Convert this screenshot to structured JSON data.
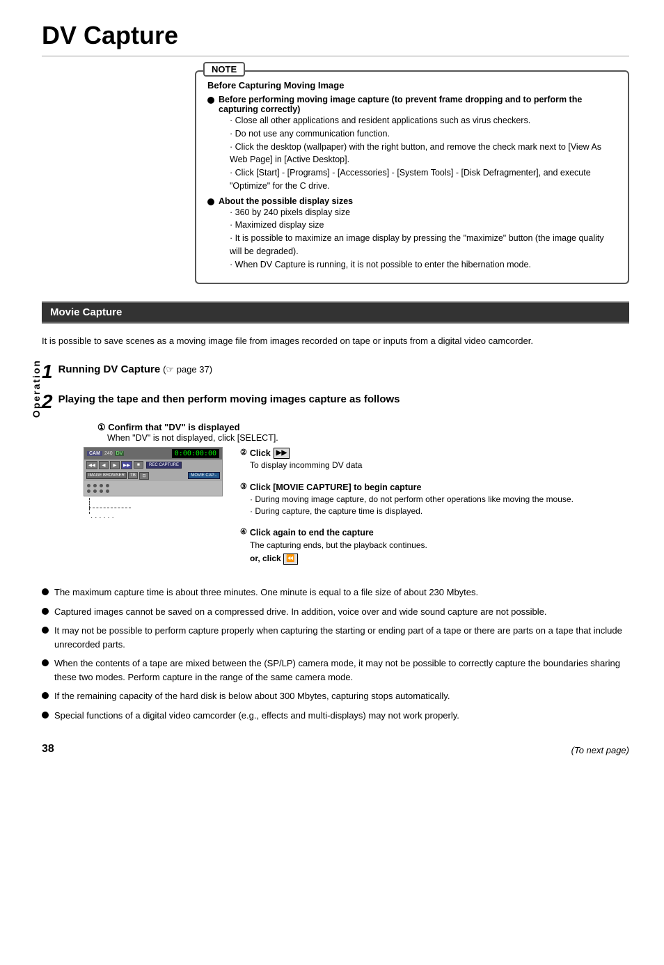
{
  "page": {
    "title": "DV Capture",
    "sidebar_label": "Operation",
    "page_number": "38",
    "next_page_text": "(To next page)"
  },
  "note": {
    "label": "NOTE",
    "title": "Before Capturing Moving Image",
    "bullets": [
      {
        "text_bold": "Before performing moving image capture (to prevent frame dropping and to perform the capturing correctly)",
        "sub_items": [
          "Close all other applications and resident applications such as virus checkers.",
          "Do not use any communication function.",
          "Click the desktop (wallpaper) with the right button, and remove the check mark next to [View As Web Page] in [Active Desktop].",
          "Click [Start] - [Programs] - [Accessories] - [System Tools] - [Disk Defragmenter], and execute \"Optimize\" for the C drive."
        ]
      },
      {
        "text_bold": "About the possible display sizes",
        "sub_items": [
          "360 by 240 pixels display size",
          "Maximized display size",
          "It is possible to maximize an image display by pressing the \"maximize\" button (the image quality will be degraded).",
          "When DV Capture is running, it is not possible to enter the hibernation mode."
        ]
      }
    ]
  },
  "movie_capture": {
    "section_title": "Movie Capture",
    "intro_text": "It is possible to save scenes as a moving image file from images recorded on tape or inputs from a digital video camcorder.",
    "step1": {
      "number": "1",
      "title": "Running DV Capture",
      "ref": "(☞ page 37)"
    },
    "step2": {
      "number": "2",
      "title": "Playing the tape and then perform moving images capture as follows",
      "sub1": {
        "number": "①",
        "title": "Confirm that \"DV\" is displayed",
        "note": "When \"DV\" is not displayed, click [SELECT]."
      },
      "sub2": {
        "number": "②",
        "title": "Click",
        "btn_label": "▶▶",
        "note": "To display incomming DV data"
      },
      "sub3": {
        "number": "③",
        "title": "Click [MOVIE CAPTURE] to begin capture",
        "sub_notes": [
          "During moving image capture, do not perform other operations like moving the mouse.",
          "During capture, the capture time is displayed."
        ]
      },
      "sub4": {
        "number": "④",
        "title": "Click again to end the capture",
        "note": "The capturing ends, but the playback continues.",
        "or_click": "or, click"
      }
    },
    "dv_ui": {
      "badge": "CAM",
      "num": "240",
      "dv_label": "DV",
      "timecode": "0:00:00:00",
      "ctrl_btns": [
        "◀◀",
        "◀",
        "▶",
        "▶▶",
        "■",
        "REC CAPTURE"
      ],
      "bottom_btns": [
        "IMAGE BROWSER",
        "TB",
        "⊡",
        "MOVIE CAP..."
      ]
    },
    "bullet_notes": [
      "The maximum capture time is about three minutes. One minute is equal to a file size of about 230 Mbytes.",
      "Captured images cannot be saved on a compressed drive. In addition, voice over and wide sound capture are not possible.",
      "It may not be possible to perform capture properly when capturing the starting or ending part of a tape or there are parts on a tape that include unrecorded parts.",
      "When the contents of a tape are mixed between the (SP/LP) camera mode, it may not be possible to correctly capture the boundaries sharing these two modes. Perform capture in the range of the same camera mode.",
      "If the remaining capacity of the hard disk is below about 300 Mbytes, capturing stops automatically.",
      "Special functions of a digital video camcorder (e.g., effects and multi-displays) may not work properly."
    ]
  }
}
